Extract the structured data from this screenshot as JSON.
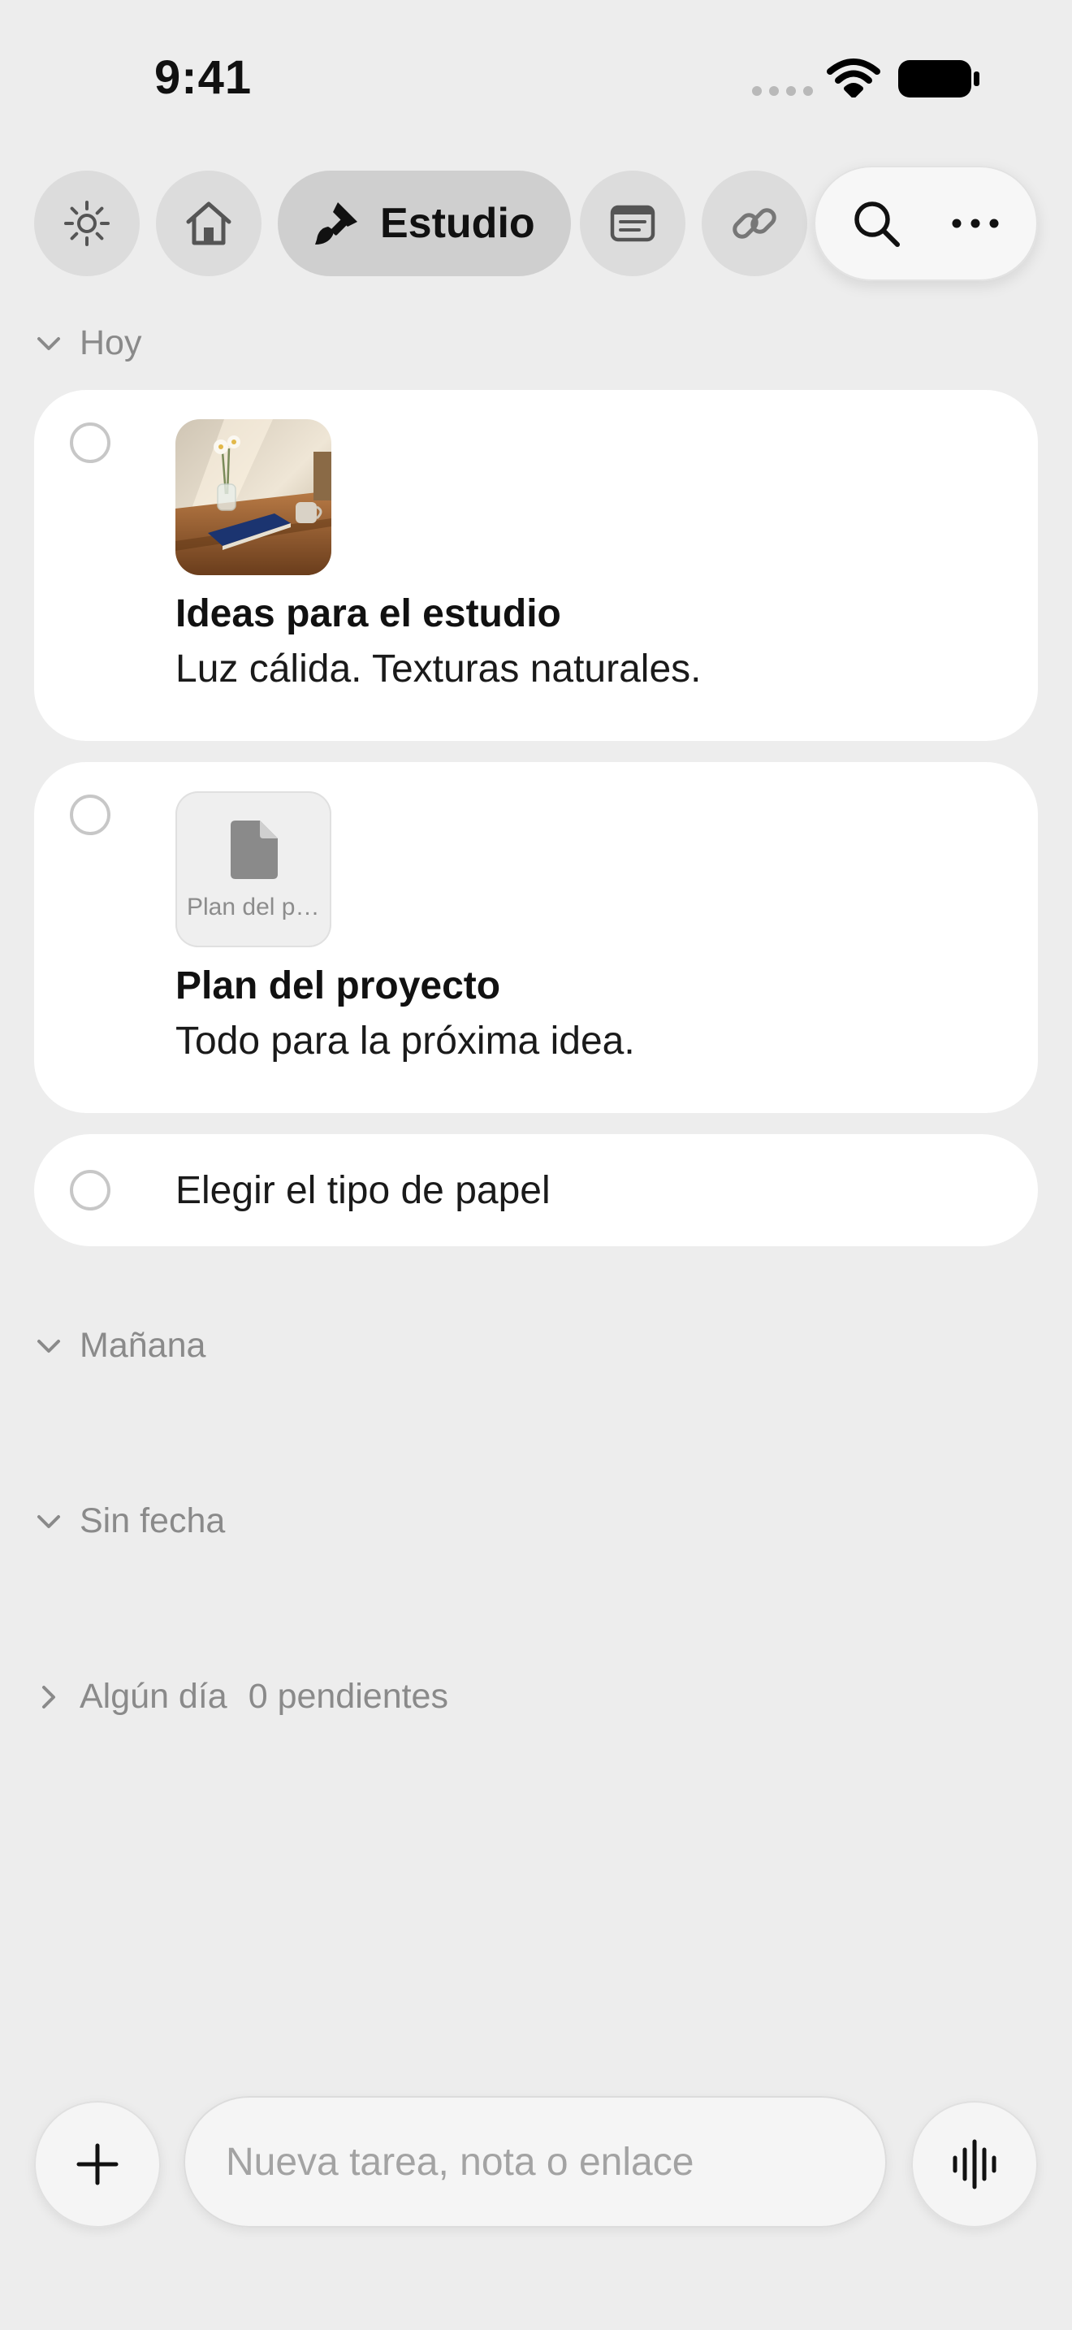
{
  "status_bar": {
    "time": "9:41"
  },
  "top_bar": {
    "tabs": [
      {
        "icon": "sun-icon"
      },
      {
        "icon": "house-icon"
      },
      {
        "icon": "paintbrush-icon",
        "label": "Estudio",
        "active": true
      },
      {
        "icon": "note-icon"
      },
      {
        "icon": "link-icon"
      }
    ],
    "actions": [
      {
        "icon": "search-icon"
      },
      {
        "icon": "ellipsis-icon"
      }
    ]
  },
  "sections": {
    "today": {
      "title": "Hoy",
      "expanded": true
    },
    "tomorrow": {
      "title": "Mañana",
      "expanded": true
    },
    "no_date": {
      "title": "Sin fecha",
      "expanded": true
    },
    "someday": {
      "title": "Algún día",
      "count_label": "0 pendientes",
      "expanded": false
    }
  },
  "tasks": [
    {
      "title": "Ideas para el estudio",
      "subtitle": "Luz cálida. Texturas naturales.",
      "attachment": "photo"
    },
    {
      "title": "Plan del proyecto",
      "subtitle": "Todo para la próxima idea.",
      "attachment": "file",
      "attachment_name": "Plan del proyecto"
    },
    {
      "title": "Elegir el tipo de papel"
    }
  ],
  "composer": {
    "placeholder": "Nueva tarea, nota o enlace",
    "add_icon": "plus-icon",
    "voice_icon": "waveform-icon"
  }
}
